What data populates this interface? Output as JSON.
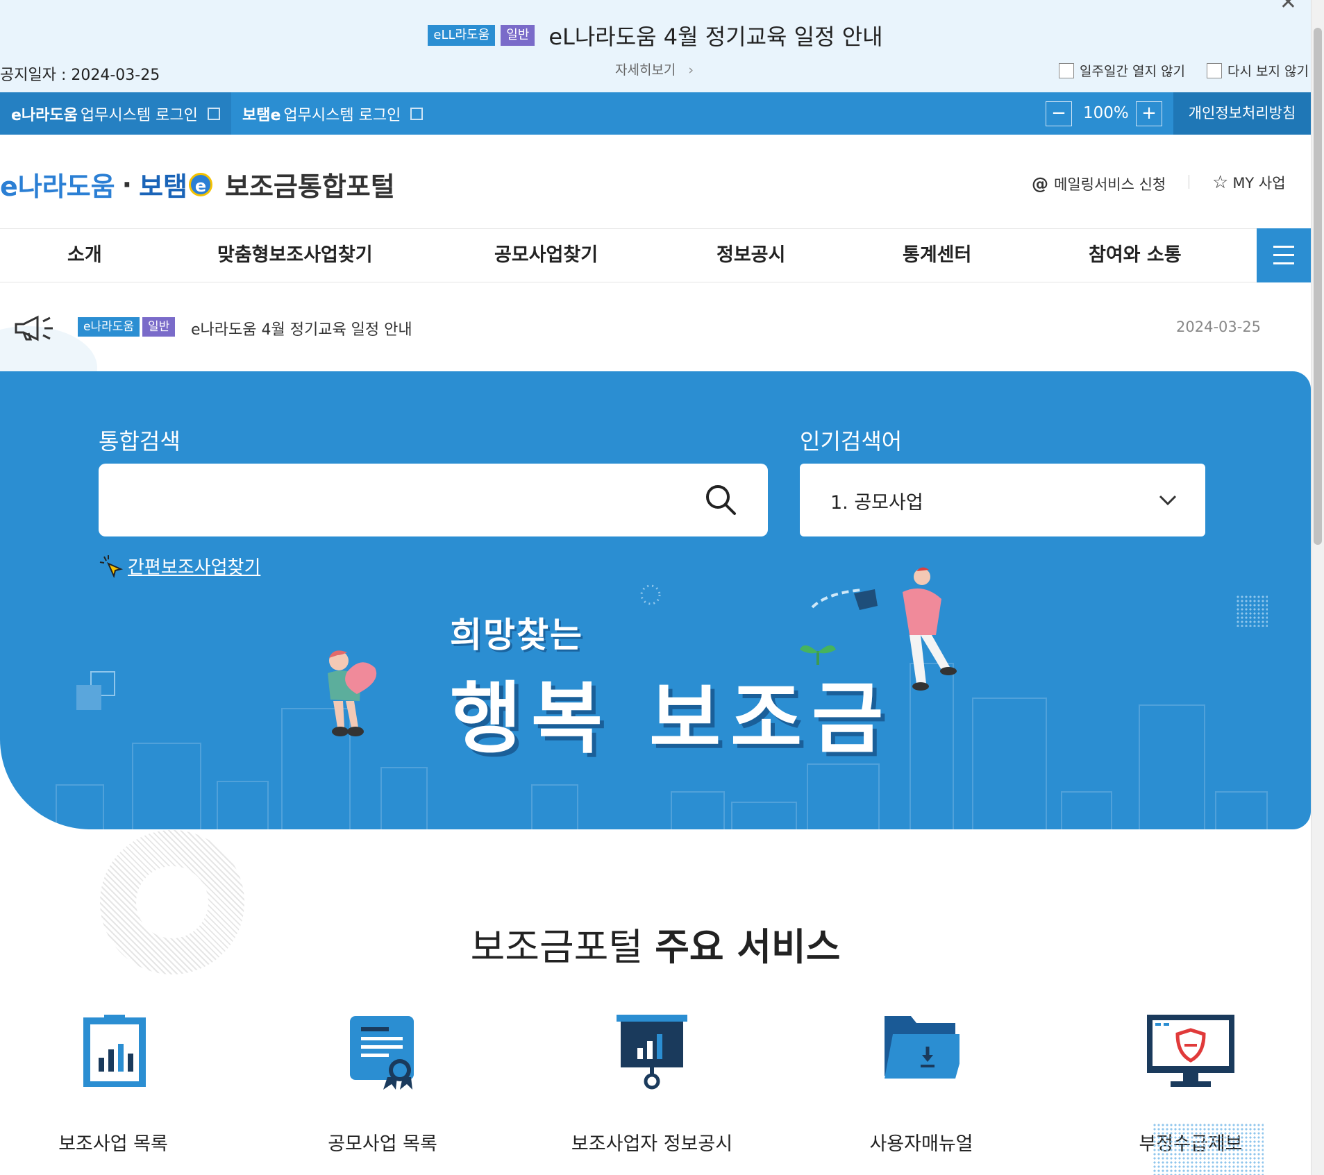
{
  "notice_popup": {
    "tag_site": "eLL라도움",
    "tag_type": "일반",
    "title": "eL나라도움 4월 정기교육 일정 안내",
    "date": "공지일자 : 2024-03-25",
    "more": "자세히보기",
    "no_week": "일주일간 열지 않기",
    "no_again": "다시 보지 않기"
  },
  "util": {
    "enara_brand": "e나라도움",
    "enara_rest": "업무시스템 로그인",
    "botem_brand": "보탬e",
    "botem_rest": "업무시스템 로그인",
    "zoom_minus": "−",
    "zoom_value": "100%",
    "zoom_plus": "+",
    "privacy": "개인정보처리방침"
  },
  "header": {
    "logo_part1": "e나라도움",
    "logo_dot": "·",
    "logo_part2": "보탬",
    "logo_e": "e",
    "logo_portal": "보조금통합포털",
    "mailing": "메일링서비스 신청",
    "my_biz": "MY 사업"
  },
  "gnb": [
    "소개",
    "맞춤형보조사업찾기",
    "공모사업찾기",
    "정보공시",
    "통계센터",
    "참여와 소통"
  ],
  "notice_line": {
    "tag_site": "e나라도움",
    "tag_type": "일반",
    "title": "e나라도움 4월 정기교육 일정 안내",
    "date": "2024-03-25"
  },
  "hero": {
    "search_label": "통합검색",
    "search_value": "",
    "popular_label": "인기검색어",
    "popular_value": "1. 공모사업",
    "quick_find": "간편보조사업찾기",
    "slogan_small": "희망찾는",
    "slogan_big": "행복 보조금"
  },
  "services": {
    "title_light": "보조금포털",
    "title_bold": "주요 서비스",
    "items": [
      {
        "label": "보조사업 목록",
        "icon": "clipboard-chart-icon"
      },
      {
        "label": "공모사업 목록",
        "icon": "certificate-icon"
      },
      {
        "label": "보조사업자 정보공시",
        "icon": "presentation-board-icon"
      },
      {
        "label": "사용자매뉴얼",
        "icon": "folder-download-icon"
      },
      {
        "label": "부정수급제보",
        "icon": "monitor-shield-icon"
      }
    ]
  },
  "colors": {
    "primary": "#2b8ed2",
    "dark_primary": "#1f77b6",
    "purple_tag": "#7a6bc9",
    "notice_bg": "#e9f4fc"
  }
}
